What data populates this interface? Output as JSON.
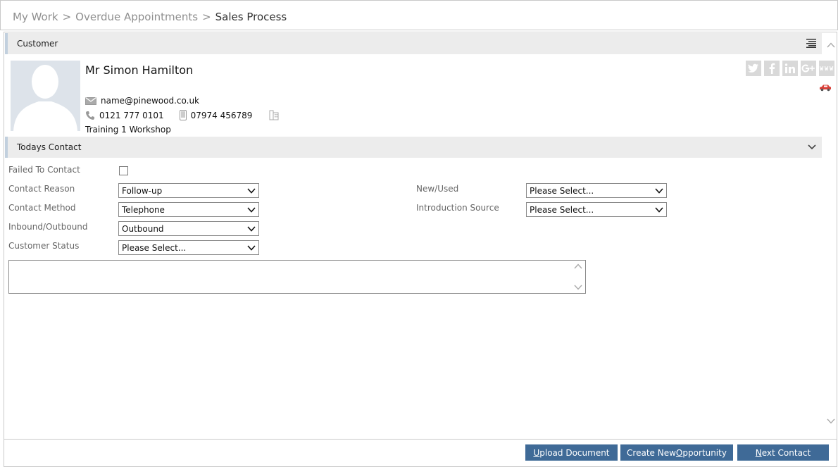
{
  "breadcrumb": {
    "items": [
      "My Work",
      "Overdue Appointments"
    ],
    "separator": ">",
    "current": "Sales Process"
  },
  "customer_section": {
    "title": "Customer",
    "name": "Mr Simon Hamilton",
    "email": "name@pinewood.co.uk",
    "phone": "0121 777 0101",
    "mobile": "07974 456789",
    "company": "Training 1 Workshop",
    "social": [
      "twitter-icon",
      "facebook-icon",
      "linkedin-icon",
      "google-plus-icon",
      "www-icon"
    ]
  },
  "contact_section": {
    "title": "Todays Contact",
    "failed_to_contact_label": "Failed To Contact",
    "failed_to_contact_checked": false,
    "contact_reason_label": "Contact Reason",
    "contact_reason_value": "Follow-up",
    "contact_method_label": "Contact Method",
    "contact_method_value": "Telephone",
    "inbound_outbound_label": "Inbound/Outbound",
    "inbound_outbound_value": "Outbound",
    "customer_status_label": "Customer Status",
    "customer_status_value": "Please Select...",
    "new_used_label": "New/Used",
    "new_used_value": "Please Select...",
    "intro_source_label": "Introduction Source",
    "intro_source_value": "Please Select...",
    "notes_value": ""
  },
  "footer": {
    "upload_document": {
      "first": "U",
      "rest": "pload Document"
    },
    "create_opportunity": {
      "before": "Create New ",
      "u": "O",
      "after": "pportunity"
    },
    "next_contact": {
      "u": "N",
      "rest": "ext Contact"
    }
  },
  "colors": {
    "button_bg": "#3f6a97",
    "section_bg": "#ececec",
    "section_accent": "#c2d0de",
    "social_icon": "#d9d9d9",
    "car_icon": "#d9413a"
  }
}
